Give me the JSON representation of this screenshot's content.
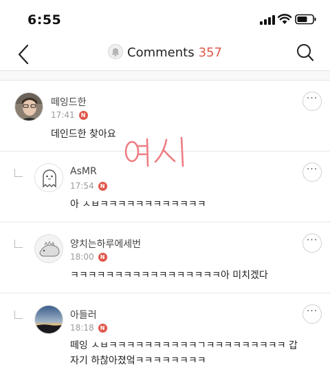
{
  "status_bar": {
    "time": "6:55"
  },
  "nav": {
    "title": "Comments",
    "count": "357"
  },
  "overlay": {
    "handwriting": "여시"
  },
  "comments": [
    {
      "author": "떼잉드한",
      "time": "17:41",
      "badge": "N",
      "text": "데인드한 찾아요",
      "reply": false,
      "avatar": "photo-avatar"
    },
    {
      "author": "AsMR",
      "time": "17:54",
      "badge": "N",
      "text": "아 ㅅㅂㅋㅋㅋㅋㅋㅋㅋㅋㅋㅋㅋㅋ",
      "reply": true,
      "avatar": "ghost-avatar"
    },
    {
      "author": "양치는하루에세번",
      "time": "18:00",
      "badge": "N",
      "text": "ㅋㅋㅋㅋㅋㅋㅋㅋㅋㅋㅋㅋㅋㅋㅋㅋㅋ아 미치겠다",
      "reply": true,
      "avatar": "dino-avatar"
    },
    {
      "author": "아들러",
      "time": "18:18",
      "badge": "N",
      "text_line1": "떼잉 ㅅㅂㅋㅋㅋㅋㅋㅋㅋㅋㅋㅋㄱㅋㅋㅋㅋㅋㅋㅋㅋㅋ 갑",
      "text_line2": "자기 하찮아졌엌ㅋㅋㅋㅋㅋㅋㅋㅋ",
      "reply": true,
      "avatar": "sunset-avatar"
    }
  ],
  "more_label": "···",
  "colors": {
    "accent": "#e0574b",
    "handwriting": "#ee7d82"
  }
}
